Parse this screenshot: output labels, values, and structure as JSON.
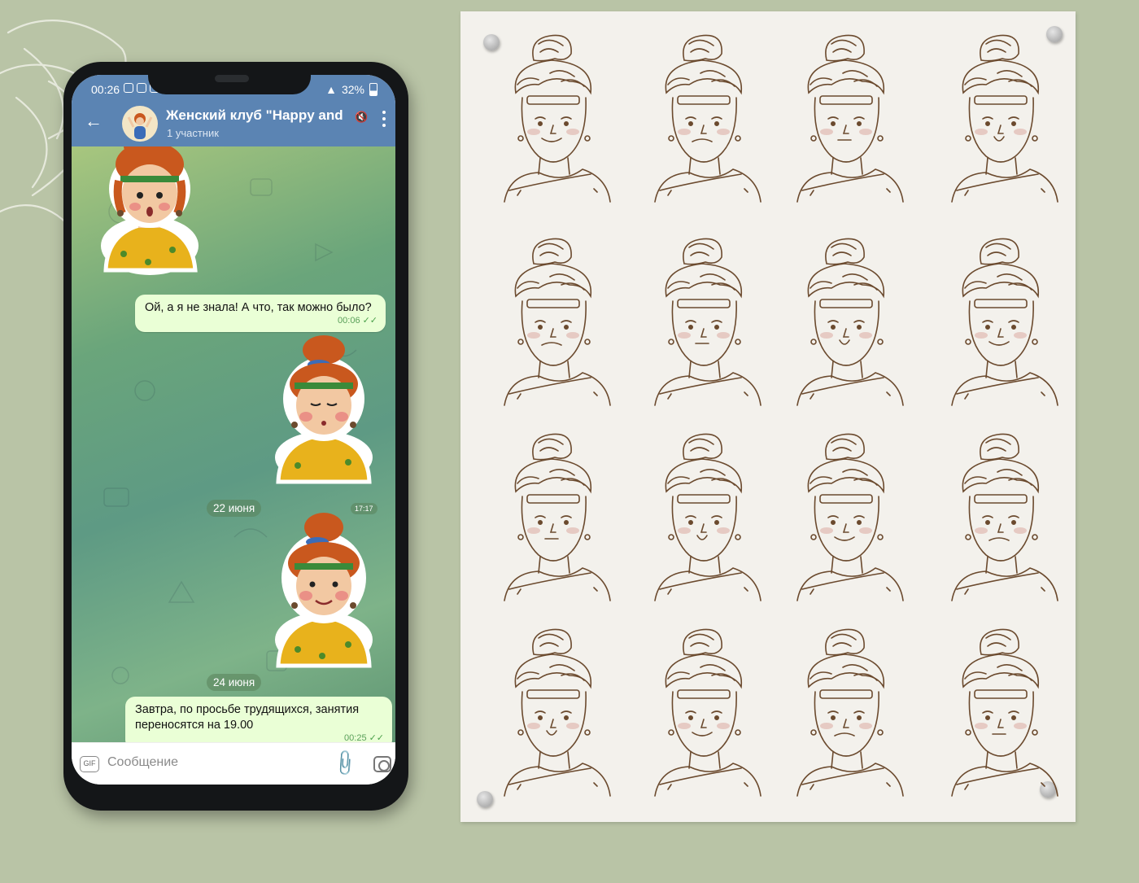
{
  "status_bar": {
    "time": "00:26",
    "battery": "32%"
  },
  "header": {
    "back_icon": "arrow-left-icon",
    "group_title": "Женский клуб \"Happy and",
    "subtitle": "1 участник",
    "mute_icon": "speaker-mute-icon",
    "menu_icon": "more-vertical-icon"
  },
  "messages": [
    {
      "text": "Ой, а я не знала! А что, так можно было?",
      "time": "00:06"
    },
    {
      "text": "Завтра, по просьбе трудящихся, занятия переносятся на 19.00",
      "time": "00:25"
    }
  ],
  "dates": {
    "first": "22 июня",
    "second": "24 июня"
  },
  "sticker_time": "17:17",
  "input": {
    "gif_label": "GIF",
    "placeholder": "Сообщение",
    "attach_icon": "paperclip-icon",
    "camera_icon": "camera-icon"
  },
  "colors": {
    "header": "#5b84b3",
    "bubble": "#eaffd6",
    "hair": "#c9581e",
    "background": "#b9c4a6",
    "ink": "#6b4a2e"
  }
}
